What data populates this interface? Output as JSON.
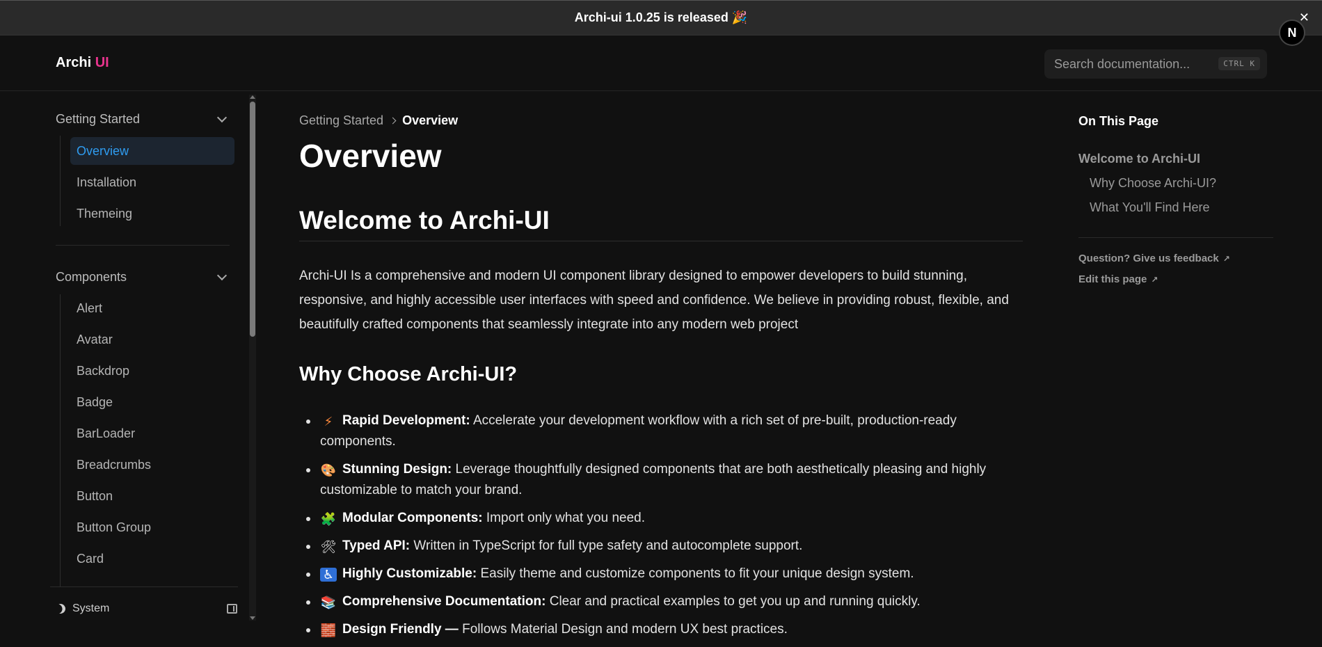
{
  "banner": {
    "text": "Archi-ui 1.0.25 is released 🎉",
    "close": "✕"
  },
  "floating_badge": "N",
  "header": {
    "logo_main": "Archi",
    "logo_accent": "UI",
    "search_placeholder": "Search documentation...",
    "search_shortcut": "CTRL K"
  },
  "sidebar": {
    "groups": [
      {
        "label": "Getting Started",
        "items": [
          "Overview",
          "Installation",
          "Themeing"
        ],
        "active": "Overview"
      },
      {
        "label": "Components",
        "items": [
          "Alert",
          "Avatar",
          "Backdrop",
          "Badge",
          "BarLoader",
          "Breadcrumbs",
          "Button",
          "Button Group",
          "Card"
        ]
      }
    ],
    "theme_label": "System"
  },
  "breadcrumb": {
    "parent": "Getting Started",
    "current": "Overview"
  },
  "content": {
    "title": "Overview",
    "welcome_heading": "Welcome to Archi-UI",
    "intro": "Archi-UI Is a comprehensive and modern UI component library designed to empower developers to build stunning, responsive, and highly accessible user interfaces with speed and confidence. We believe in providing robust, flexible, and beautifully crafted components that seamlessly integrate into any modern web project",
    "why_heading": "Why Choose Archi-UI?",
    "features": [
      {
        "icon": "⚡",
        "title": "Rapid Development:",
        "text": "Accelerate your development workflow with a rich set of pre-built, production-ready components."
      },
      {
        "icon": "🎨",
        "title": "Stunning Design:",
        "text": "Leverage thoughtfully designed components that are both aesthetically pleasing and highly customizable to match your brand."
      },
      {
        "icon": "🧩",
        "title": "Modular Components:",
        "text": "Import only what you need."
      },
      {
        "icon": "🛠",
        "title": "Typed API:",
        "text": "Written in TypeScript for full type safety and autocomplete support."
      },
      {
        "icon": "♿",
        "title": "Highly Customizable:",
        "text": "Easily theme and customize components to fit your unique design system."
      },
      {
        "icon": "📚",
        "title": "Comprehensive Documentation:",
        "text": "Clear and practical examples to get you up and running quickly."
      },
      {
        "icon": "🧱",
        "title": "Design Friendly —",
        "text": "Follows Material Design and modern UX best practices."
      }
    ]
  },
  "toc": {
    "title": "On This Page",
    "links": [
      "Welcome to Archi-UI",
      "Why Choose Archi-UI?",
      "What You'll Find Here"
    ],
    "feedback": "Question? Give us feedback",
    "edit": "Edit this page"
  },
  "colors": {
    "background": "#111111",
    "accent": "#e8348d",
    "active_link": "#2f9cf0"
  }
}
